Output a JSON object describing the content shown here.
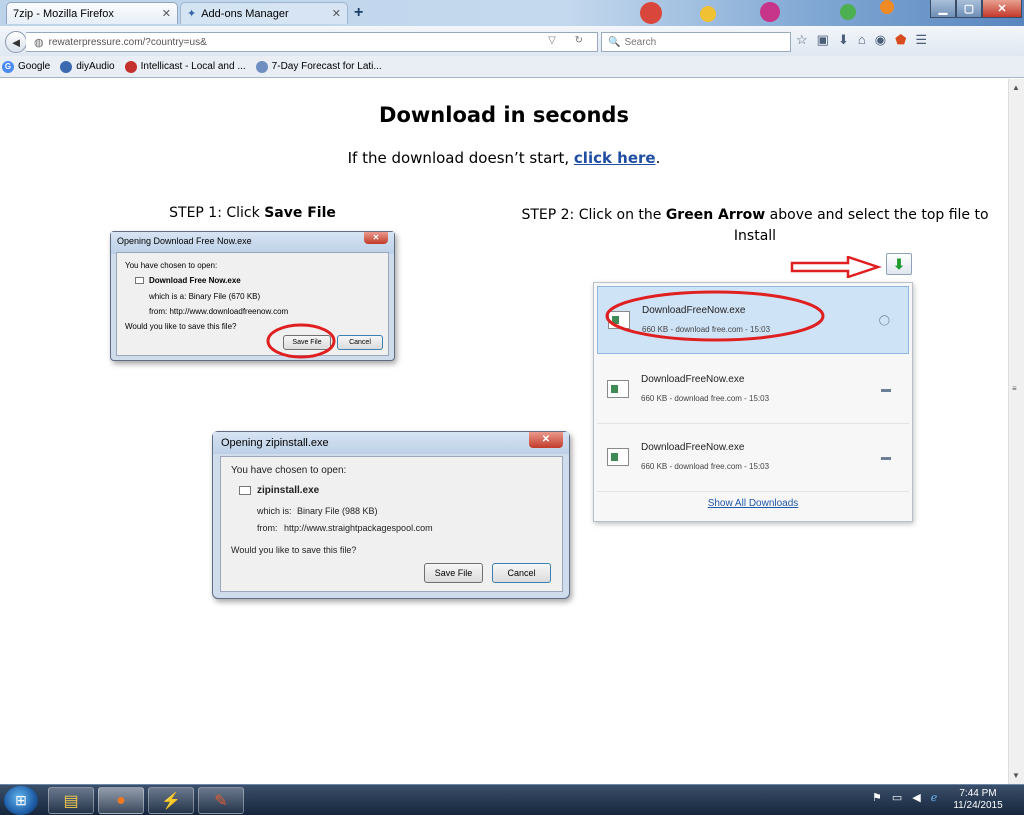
{
  "window": {
    "tabs": [
      {
        "label": "7zip - Mozilla Firefox"
      },
      {
        "label": "Add-ons Manager"
      }
    ],
    "new_tab": "+",
    "minimize": "▁",
    "maximize": "▢",
    "close": "✕"
  },
  "nav": {
    "back": "◄",
    "url": "rewaterpressure.com/?country=us&",
    "search_placeholder": "Search"
  },
  "bookmarks": [
    {
      "label": "Google"
    },
    {
      "label": "diyAudio"
    },
    {
      "label": "Intellicast - Local and ..."
    },
    {
      "label": "7-Day Forecast for Lati..."
    }
  ],
  "page": {
    "headline": "Download in seconds",
    "subline_prefix": "If the download doesn’t start, ",
    "subline_link": "click here",
    "subline_suffix": ".",
    "step1_prefix": "STEP 1: Click ",
    "step1_bold": "Save File",
    "step2_prefix": "STEP 2: Click on the ",
    "step2_bold": "Green Arrow",
    "step2_suffix": " above and select the top file to Install"
  },
  "dialog_small": {
    "title": "Opening Download Free Now.exe",
    "chosen": "You have chosen to open:",
    "filename": "Download Free Now.exe",
    "which_is": "which is a:  Binary File (670 KB)",
    "from": "from: http://www.downloadfreenow.com",
    "question": "Would you like to save this file?",
    "save": "Save File",
    "cancel": "Cancel"
  },
  "dialog_large": {
    "title": "Opening zipinstall.exe",
    "chosen": "You have chosen to open:",
    "filename": "zipinstall.exe",
    "which_is_label": "which is:",
    "which_is_value": "Binary File (988 KB)",
    "from_label": "from:",
    "from_value": "http://www.straightpackagespool.com",
    "question": "Would you like to save this file?",
    "save": "Save File",
    "cancel": "Cancel"
  },
  "downloads_panel": {
    "items": [
      {
        "name": "DownloadFreeNow.exe",
        "meta": "660 KB - download free.com - 15:03"
      },
      {
        "name": "DownloadFreeNow.exe",
        "meta": "660 KB - download free.com - 15:03"
      },
      {
        "name": "DownloadFreeNow.exe",
        "meta": "660 KB - download free.com - 15:03"
      }
    ],
    "show_all": "Show All Downloads"
  },
  "taskbar": {
    "time": "7:44 PM",
    "date": "11/24/2015"
  },
  "colors": {
    "annotation_red": "#e02020",
    "link_blue": "#1f4ea3",
    "highlight_row": "#cfe3f7",
    "green_arrow": "#1d9a2c"
  }
}
